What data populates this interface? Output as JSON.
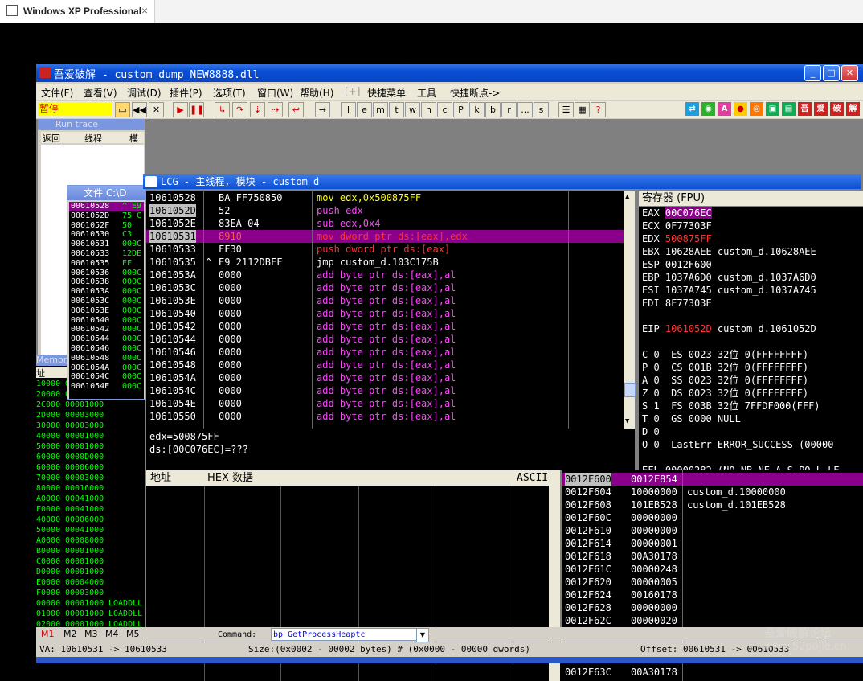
{
  "host": {
    "tab_title": "Windows XP Professional",
    "close": "×"
  },
  "window": {
    "title": "吾爱破解 - custom_dump_NEW8888.dll",
    "buttons": {
      "min": "_",
      "max": "□",
      "close": "✕"
    }
  },
  "menu": [
    "文件(F)",
    "查看(V)",
    "调试(D)",
    "插件(P)",
    "选项(T)",
    "窗口(W)",
    "帮助(H)",
    "[+]",
    "快捷菜单",
    "工具",
    "快捷断点->"
  ],
  "toolbar": {
    "state": "暂停",
    "letters": [
      "l",
      "e",
      "m",
      "t",
      "w",
      "h",
      "c",
      "P",
      "k",
      "b",
      "r",
      "...",
      "s"
    ],
    "right_glyphs": [
      "吾",
      "爱",
      "破",
      "解"
    ]
  },
  "runtrace": {
    "title": "Run trace",
    "cols": [
      "返回",
      "线程",
      "模块"
    ]
  },
  "filewin": {
    "title": "文件 C:\\D",
    "rows": [
      [
        "00610528",
        "^ E9 2"
      ],
      [
        "0061052D",
        "75 C"
      ],
      [
        "0061052F",
        "50"
      ],
      [
        "00610530",
        "C3"
      ],
      [
        "00610531",
        "000C"
      ],
      [
        "00610533",
        "12DE"
      ],
      [
        "00610535",
        "EF"
      ],
      [
        "00610536",
        "000C"
      ],
      [
        "00610538",
        "000C"
      ],
      [
        "0061053A",
        "000C"
      ],
      [
        "0061053C",
        "000C"
      ],
      [
        "0061053E",
        "000C"
      ],
      [
        "00610540",
        "000C"
      ],
      [
        "00610542",
        "000C"
      ],
      [
        "00610544",
        "000C"
      ],
      [
        "00610546",
        "000C"
      ],
      [
        "00610548",
        "000C"
      ],
      [
        "0061054A",
        "000C"
      ],
      [
        "0061054C",
        "000C"
      ],
      [
        "0061054E",
        "000C"
      ]
    ]
  },
  "memory": {
    "title": "Memor",
    "col": "址",
    "rows": [
      [
        "10000",
        "00001000",
        ""
      ],
      [
        "20000",
        "00001000",
        ""
      ],
      [
        "2C000",
        "00001000",
        ""
      ],
      [
        "2D000",
        "00003000",
        ""
      ],
      [
        "30000",
        "00003000",
        ""
      ],
      [
        "40000",
        "00001000",
        ""
      ],
      [
        "50000",
        "00001000",
        ""
      ],
      [
        "60000",
        "0000D000",
        ""
      ],
      [
        "60000",
        "00006000",
        ""
      ],
      [
        "70000",
        "00003000",
        ""
      ],
      [
        "80000",
        "00016000",
        ""
      ],
      [
        "A0000",
        "00041000",
        ""
      ],
      [
        "F0000",
        "00041000",
        ""
      ],
      [
        "40000",
        "00006000",
        ""
      ],
      [
        "50000",
        "00041000",
        ""
      ],
      [
        "A0000",
        "00008000",
        ""
      ],
      [
        "B0000",
        "00001000",
        ""
      ],
      [
        "C0000",
        "00001000",
        ""
      ],
      [
        "D0000",
        "00001000",
        ""
      ],
      [
        "E0000",
        "00004000",
        ""
      ],
      [
        "F0000",
        "00003000",
        ""
      ],
      [
        "00000",
        "00001000",
        "LOADDLL"
      ],
      [
        "01000",
        "00001000",
        "LOADDLL"
      ],
      [
        "02000",
        "00001000",
        "LOADDLL"
      ],
      [
        "03000",
        "00001000",
        "LOADDLL"
      ]
    ]
  },
  "cpu": {
    "title": "LCG -  主线程, 模块 - custom_d"
  },
  "disasm": [
    {
      "addr": "10610528",
      "hex": "BA FF750850",
      "ins": "mov edx,0x500875FF",
      "cls": "y",
      "sel": false,
      "mark": ""
    },
    {
      "addr": "1061052D",
      "hex": "52",
      "ins": "push edx",
      "cls": "b",
      "sel": false,
      "mark": ""
    },
    {
      "addr": "1061052E",
      "hex": "83EA 04",
      "ins": "sub edx,0x4",
      "cls": "b",
      "sel": false,
      "mark": ""
    },
    {
      "addr": "10610531",
      "hex": "8910",
      "ins": "mov dword ptr ds:[eax],edx",
      "cls": "r",
      "sel": true,
      "mark": ""
    },
    {
      "addr": "10610533",
      "hex": "FF30",
      "ins": "push dword ptr ds:[eax]",
      "cls": "r",
      "sel": false,
      "mark": ""
    },
    {
      "addr": "10610535",
      "hex": "E9 2112DBFF",
      "ins": "jmp custom_d.103C175B",
      "cls": "j",
      "sel": false,
      "mark": "^"
    },
    {
      "addr": "1061053A",
      "hex": "0000",
      "ins": "add byte ptr ds:[eax],al",
      "cls": "a",
      "sel": false,
      "mark": ""
    },
    {
      "addr": "1061053C",
      "hex": "0000",
      "ins": "add byte ptr ds:[eax],al",
      "cls": "a",
      "sel": false,
      "mark": ""
    },
    {
      "addr": "1061053E",
      "hex": "0000",
      "ins": "add byte ptr ds:[eax],al",
      "cls": "a",
      "sel": false,
      "mark": ""
    },
    {
      "addr": "10610540",
      "hex": "0000",
      "ins": "add byte ptr ds:[eax],al",
      "cls": "a",
      "sel": false,
      "mark": ""
    },
    {
      "addr": "10610542",
      "hex": "0000",
      "ins": "add byte ptr ds:[eax],al",
      "cls": "a",
      "sel": false,
      "mark": ""
    },
    {
      "addr": "10610544",
      "hex": "0000",
      "ins": "add byte ptr ds:[eax],al",
      "cls": "a",
      "sel": false,
      "mark": ""
    },
    {
      "addr": "10610546",
      "hex": "0000",
      "ins": "add byte ptr ds:[eax],al",
      "cls": "a",
      "sel": false,
      "mark": ""
    },
    {
      "addr": "10610548",
      "hex": "0000",
      "ins": "add byte ptr ds:[eax],al",
      "cls": "a",
      "sel": false,
      "mark": ""
    },
    {
      "addr": "1061054A",
      "hex": "0000",
      "ins": "add byte ptr ds:[eax],al",
      "cls": "a",
      "sel": false,
      "mark": ""
    },
    {
      "addr": "1061054C",
      "hex": "0000",
      "ins": "add byte ptr ds:[eax],al",
      "cls": "a",
      "sel": false,
      "mark": ""
    },
    {
      "addr": "1061054E",
      "hex": "0000",
      "ins": "add byte ptr ds:[eax],al",
      "cls": "a",
      "sel": false,
      "mark": ""
    },
    {
      "addr": "10610550",
      "hex": "0000",
      "ins": "add byte ptr ds:[eax],al",
      "cls": "a",
      "sel": false,
      "mark": ""
    }
  ],
  "info": [
    "edx=500875FF",
    "ds:[00C076EC]=???"
  ],
  "registers": {
    "title": "寄存器 (FPU)",
    "lines": [
      {
        "t": "EAX ",
        "v": "00C076EC",
        "c": "hi",
        "rest": ""
      },
      {
        "t": "ECX ",
        "v": "0F77303F",
        "c": "n",
        "rest": ""
      },
      {
        "t": "EDX ",
        "v": "500875FF",
        "c": "red",
        "rest": ""
      },
      {
        "t": "EBX ",
        "v": "10628AEE",
        "c": "n",
        "rest": " custom_d.10628AEE"
      },
      {
        "t": "ESP ",
        "v": "0012F600",
        "c": "n",
        "rest": ""
      },
      {
        "t": "EBP ",
        "v": "1037A6D0",
        "c": "n",
        "rest": " custom_d.1037A6D0"
      },
      {
        "t": "ESI ",
        "v": "1037A745",
        "c": "n",
        "rest": " custom_d.1037A745"
      },
      {
        "t": "EDI ",
        "v": "8F77303E",
        "c": "n",
        "rest": ""
      },
      {
        "t": "",
        "v": "",
        "c": "n",
        "rest": ""
      },
      {
        "t": "EIP ",
        "v": "1061052D",
        "c": "red",
        "rest": " custom_d.1061052D"
      },
      {
        "t": "",
        "v": "",
        "c": "n",
        "rest": ""
      },
      {
        "t": "C 0  ES 0023 32位 0(FFFFFFFF)",
        "v": "",
        "c": "n",
        "rest": ""
      },
      {
        "t": "P 0  CS 001B 32位 0(FFFFFFFF)",
        "v": "",
        "c": "n",
        "rest": ""
      },
      {
        "t": "A 0  SS 0023 32位 0(FFFFFFFF)",
        "v": "",
        "c": "n",
        "rest": ""
      },
      {
        "t": "Z 0  DS 0023 32位 0(FFFFFFFF)",
        "v": "",
        "c": "n",
        "rest": ""
      },
      {
        "t": "S 1  FS 003B 32位 7FFDF000(FFF)",
        "v": "",
        "c": "n",
        "rest": ""
      },
      {
        "t": "T 0  GS 0000 NULL",
        "v": "",
        "c": "n",
        "rest": ""
      },
      {
        "t": "D 0",
        "v": "",
        "c": "n",
        "rest": ""
      },
      {
        "t": "O 0  LastErr ERROR_SUCCESS (00000",
        "v": "",
        "c": "n",
        "rest": ""
      },
      {
        "t": "",
        "v": "",
        "c": "n",
        "rest": ""
      },
      {
        "t": "EFL 00000282 (NO,NB,NE,A,S,PO,L,LE",
        "v": "",
        "c": "n",
        "rest": ""
      }
    ]
  },
  "dump": {
    "headers": [
      "地址",
      "HEX 数据",
      "ASCII"
    ]
  },
  "stack": [
    [
      "0012F600",
      "0012F854",
      ""
    ],
    [
      "0012F604",
      "10000000",
      "custom_d.10000000"
    ],
    [
      "0012F608",
      "101EB528",
      "custom_d.101EB528"
    ],
    [
      "0012F60C",
      "00000000",
      ""
    ],
    [
      "0012F610",
      "00000000",
      ""
    ],
    [
      "0012F614",
      "00000001",
      ""
    ],
    [
      "0012F618",
      "00A30178",
      ""
    ],
    [
      "0012F61C",
      "00000248",
      ""
    ],
    [
      "0012F620",
      "00000005",
      ""
    ],
    [
      "0012F624",
      "00160178",
      ""
    ],
    [
      "0012F628",
      "00000000",
      ""
    ],
    [
      "0012F62C",
      "00000020",
      ""
    ],
    [
      "0012F630",
      "00A30370",
      ""
    ],
    [
      "0012F634",
      "00160360",
      ""
    ],
    [
      "0012F638",
      "0000000A",
      ""
    ],
    [
      "0012F63C",
      "00A30178",
      ""
    ]
  ],
  "cmdbar": {
    "tabs": [
      "M1",
      "M2",
      "M3",
      "M4",
      "M5"
    ],
    "label": "Command:",
    "value": "bp GetProcessHeaptc"
  },
  "status": {
    "va": "VA: 10610531 -> 10610533",
    "size": "Size:(0x0002 - 00002 bytes)   #   (0x0000 - 00000 dwords)",
    "offset": "Offset: 00610531 -> 00610533"
  },
  "watermark": [
    "吾爱破解论坛",
    "www.52pojie.cn"
  ],
  "colors": {
    "accent": "#0a4fd6",
    "select": "#8b008b",
    "addr": "#ffffff",
    "ins_add": "#ff44ff",
    "ins_jmp": "#ffff00"
  }
}
